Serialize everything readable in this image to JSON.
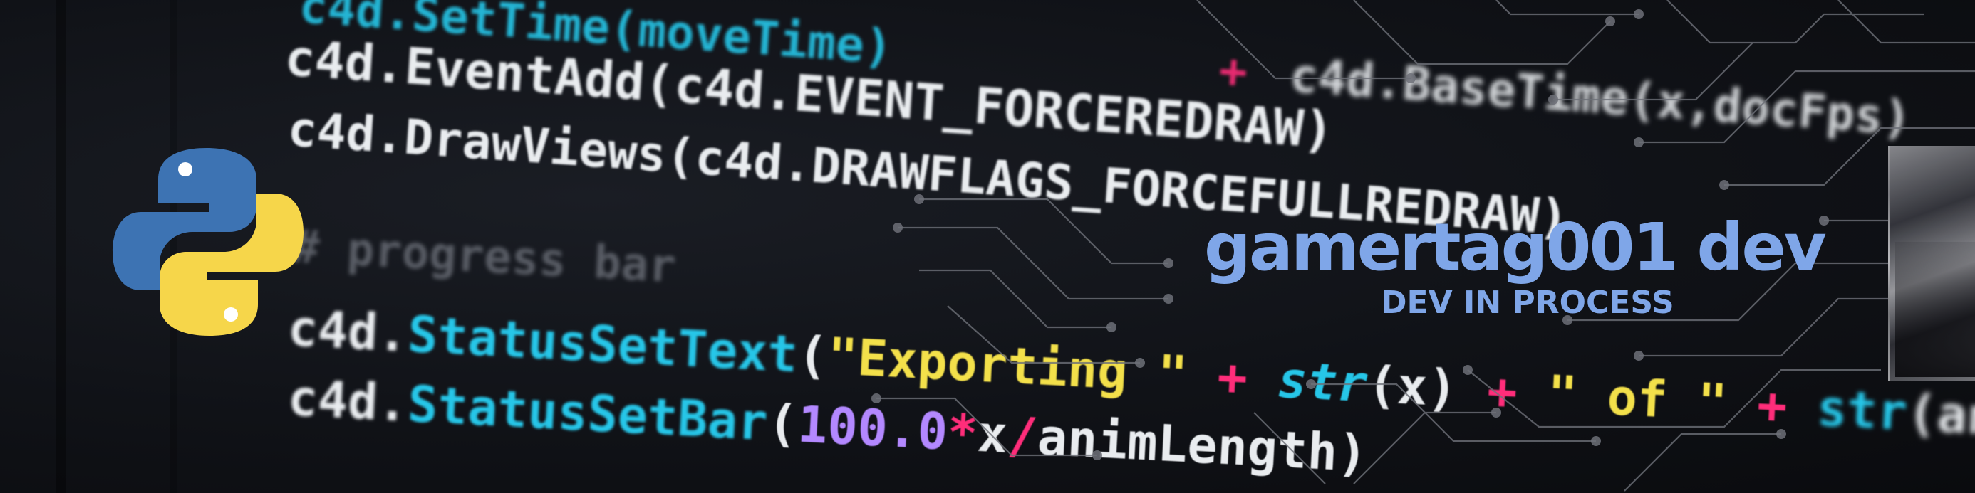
{
  "banner": {
    "title": "gamertag001 dev",
    "subtitle": "DEV IN PROCESS"
  },
  "code": {
    "line0": "c4d.SetTime(moveTime)",
    "line0b": "c4d.BaseTime(x,docFps)",
    "line1": "c4d.EventAdd(c4d.EVENT_FORCEREDRAW)",
    "line2": "c4d.DrawViews(c4d.DRAWFLAGS_FORCEFULLREDRAW)",
    "comment": "# progress bar",
    "line3a": "c4d.",
    "line3b": "StatusSetText",
    "line3c": "(",
    "line3d": "\"Exporting \"",
    "line3e": " + ",
    "line3f": "str",
    "line3g": "(x)",
    "line3h": " + ",
    "line3i": "\" of \"",
    "line3j": " + ",
    "line3k": "str",
    "line3l": "(animLength))",
    "line4a": "c4d.",
    "line4b": "StatusSetBar",
    "line4c": "(",
    "line4d": "100.0",
    "line4e": "*",
    "line4f": "x",
    "line4g": "/",
    "line4h": "animLength)"
  },
  "icons": {
    "logo": "python-logo-icon",
    "decor": "circuit-lines"
  },
  "colors": {
    "accent": "#7fa6e8",
    "python_blue": "#3d73b3",
    "python_yellow": "#f6d64a",
    "code_cyan": "#26c6e8",
    "code_yellow": "#f3e04a",
    "code_pink": "#ff2d7a",
    "code_purple": "#b388ff"
  }
}
